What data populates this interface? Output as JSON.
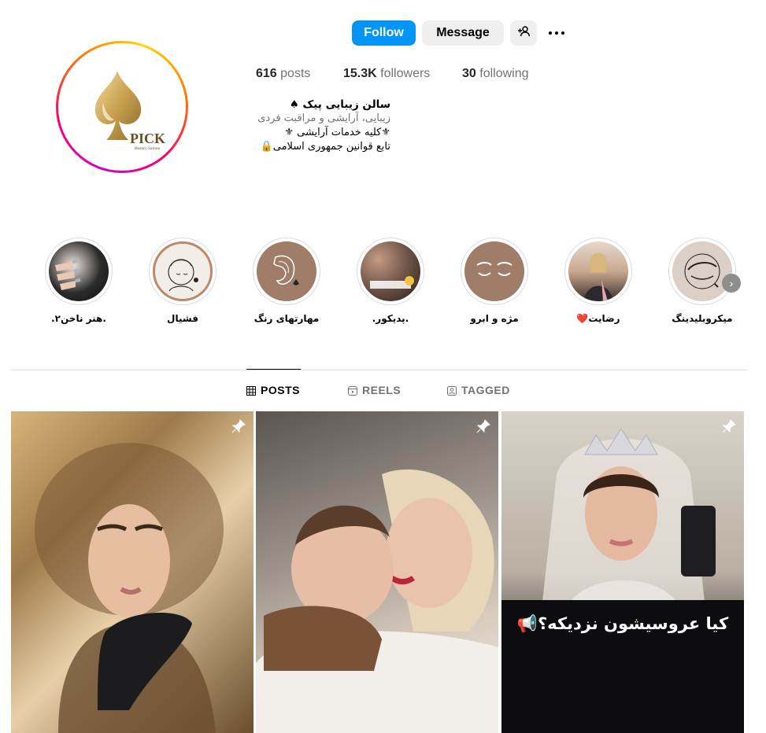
{
  "header": {
    "follow_label": "Follow",
    "message_label": "Message",
    "add_user_icon": "add-person-icon",
    "more_icon": "more-dots-icon"
  },
  "stats": {
    "posts_count": "616",
    "posts_label": "posts",
    "followers_count": "15.3K",
    "followers_label": "followers",
    "following_count": "30",
    "following_label": "following"
  },
  "bio": {
    "name": "سالن زیبایی پیک ♠",
    "category": "زیبایی، آرایشی و مراقبت فردی",
    "line1": "⚜کلیه خدمات آرایشی ⚜",
    "line2": "تابع قوانین جمهوری اسلامی🔒"
  },
  "avatar": {
    "logo_text": "PICK",
    "logo_subtext": "Beauty Saloon"
  },
  "highlights": [
    {
      "label": ".هنر ناخن۲.",
      "color": "#3c3c3c"
    },
    {
      "label": "فشیال",
      "color": "#f3ede7"
    },
    {
      "label": "مهارتهای رنگ",
      "color": "#a07d68"
    },
    {
      "label": ".پدیکور.",
      "color": "#6e5448"
    },
    {
      "label": "مژه و ابرو",
      "color": "#a07d68"
    },
    {
      "label": "رضایت❤️",
      "color": "#c9a88f"
    },
    {
      "label": "میکروبلیدینگ",
      "color": "#dccfc6"
    }
  ],
  "tabs": {
    "posts": "POSTS",
    "reels": "REELS",
    "tagged": "TAGGED"
  },
  "posts": [
    {
      "caption": ""
    },
    {
      "caption": ""
    },
    {
      "caption": "کیا عروسیشون نزدیکه؟📢"
    }
  ],
  "colors": {
    "follow_blue": "#0095f6",
    "button_gray": "#efefef",
    "text_secondary": "#737373"
  }
}
